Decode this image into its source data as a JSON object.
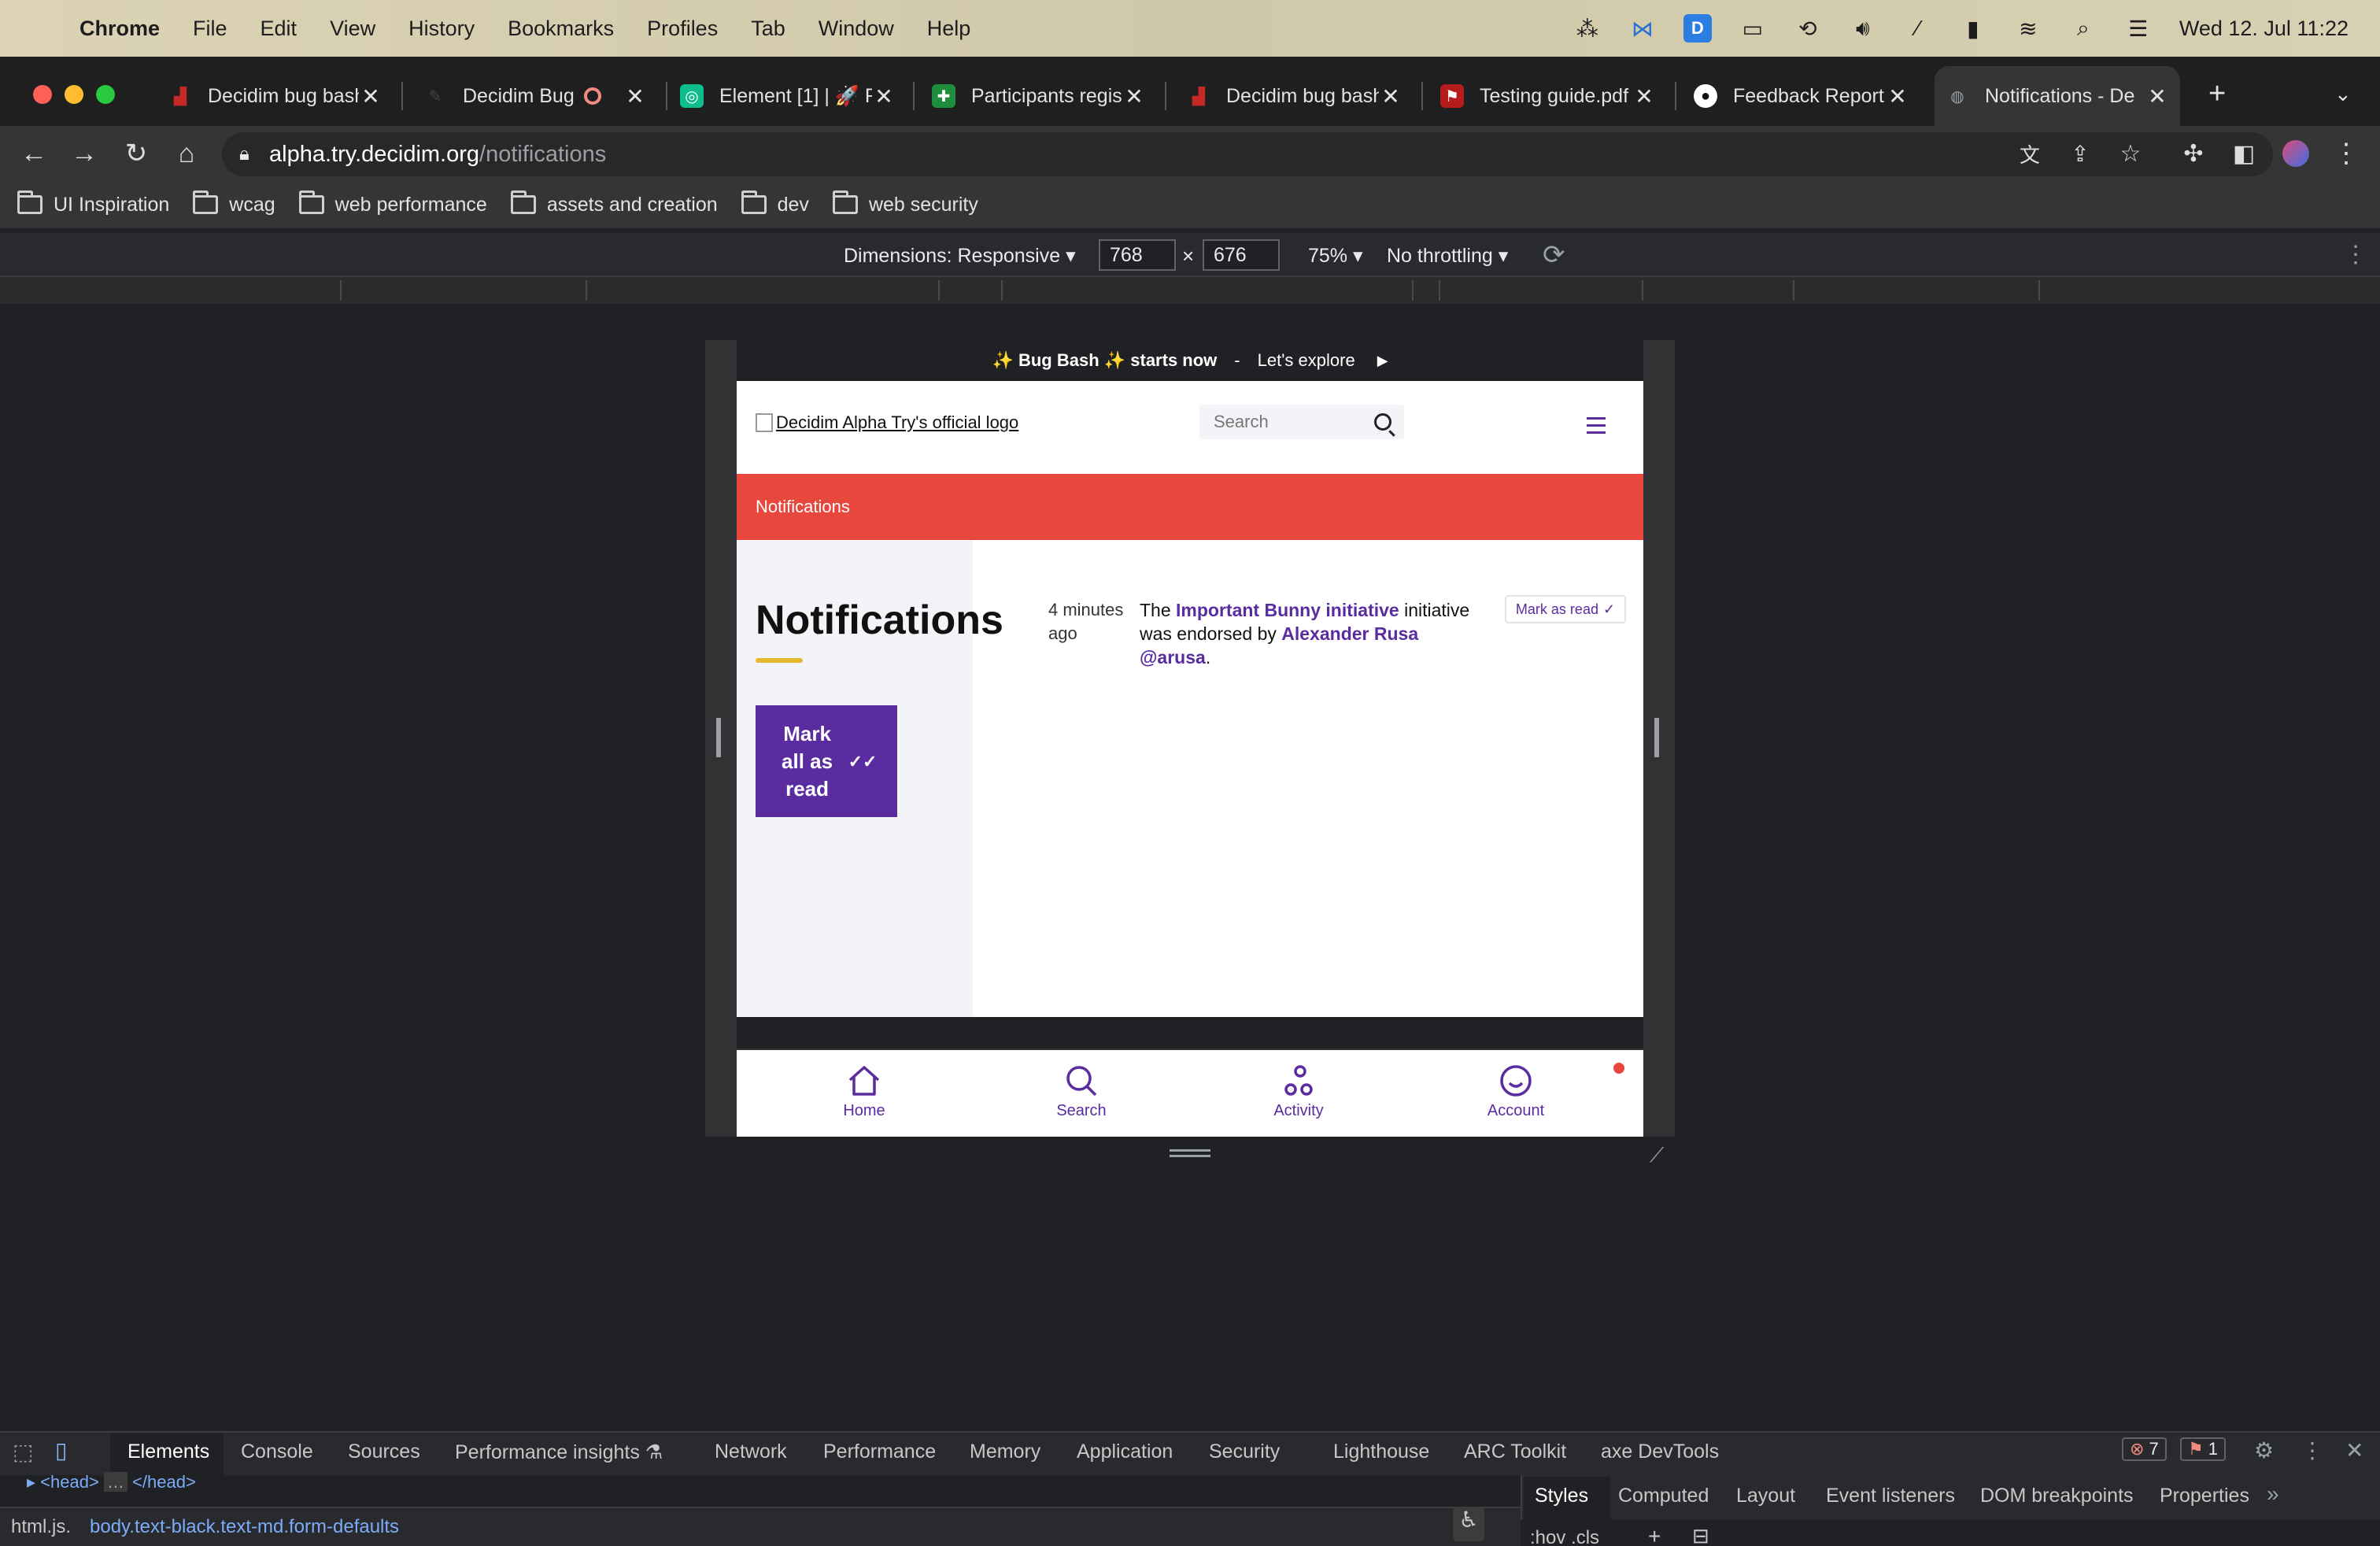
{
  "menubar": {
    "app": "Chrome",
    "items": [
      "File",
      "Edit",
      "View",
      "History",
      "Bookmarks",
      "Profiles",
      "Tab",
      "Window",
      "Help"
    ],
    "clock": "Wed 12. Jul  11:22"
  },
  "tabs": [
    {
      "title": "Decidim bug bash",
      "favicon_color": "#c62828",
      "active": false
    },
    {
      "title": "Decidim Bug",
      "favicon_color": "#555555",
      "active": false
    },
    {
      "title": "Element [1] | 🚀 R",
      "favicon_color": "#0dbd8b",
      "active": false
    },
    {
      "title": "Participants regis",
      "favicon_color": "#1e8e3e",
      "active": false
    },
    {
      "title": "Decidim bug bash",
      "favicon_color": "#c62828",
      "active": false
    },
    {
      "title": "Testing guide.pdf",
      "favicon_color": "#b71c1c",
      "active": false
    },
    {
      "title": "Feedback Report",
      "favicon_color": "#ffffff",
      "active": false
    },
    {
      "title": "Notifications - De",
      "favicon_color": "#9aa0a6",
      "active": true
    }
  ],
  "address": {
    "host": "alpha.try.decidim.org",
    "path": "/notifications"
  },
  "bookmarks": [
    "UI Inspiration",
    "wcag",
    "web performance",
    "assets and creation",
    "dev",
    "web security"
  ],
  "device_toolbar": {
    "dimensions": "Dimensions: Responsive",
    "width": "768",
    "times": "×",
    "height": "676",
    "zoom": "75%",
    "throttling": "No throttling"
  },
  "site": {
    "banner": {
      "lead": "✨ Bug Bash ✨ starts now",
      "sep": "-",
      "cta": "Let's explore"
    },
    "logo_alt": "Decidim Alpha Try's official logo",
    "search_placeholder": "Search",
    "breadcrumb": "Notifications",
    "page_title": "Notifications",
    "mark_all_label": "Mark all as read",
    "notification": {
      "time": "4 minutes ago",
      "text_prefix": "The ",
      "link1": "Important Bunny initiative",
      "text_mid": " initiative was endorsed by ",
      "link2": "Alexander Rusa @arusa",
      "text_suffix": ".",
      "mark_read": "Mark as read"
    },
    "bottom_nav": [
      "Home",
      "Search",
      "Activity",
      "Account"
    ]
  },
  "devtools": {
    "tabs": [
      "Elements",
      "Console",
      "Sources",
      "Performance insights",
      "Network",
      "Performance",
      "Memory",
      "Application",
      "Security",
      "Lighthouse",
      "ARC Toolkit",
      "axe DevTools"
    ],
    "errors": "7",
    "issues": "1",
    "dom_line1": "<head>",
    "dom_line1b": "</head>",
    "styles_tabs": [
      "Styles",
      "Computed",
      "Layout",
      "Event listeners",
      "DOM breakpoints",
      "Properties"
    ],
    "crumb1": "html.js.",
    "crumb2": "body.text-black.text-md.form-defaults",
    "styles_filter": ":hov .cls"
  },
  "colors": {
    "brand_purple": "#5a2ca0",
    "brand_red": "#e8473e",
    "accent_yellow": "#e5b92e"
  }
}
